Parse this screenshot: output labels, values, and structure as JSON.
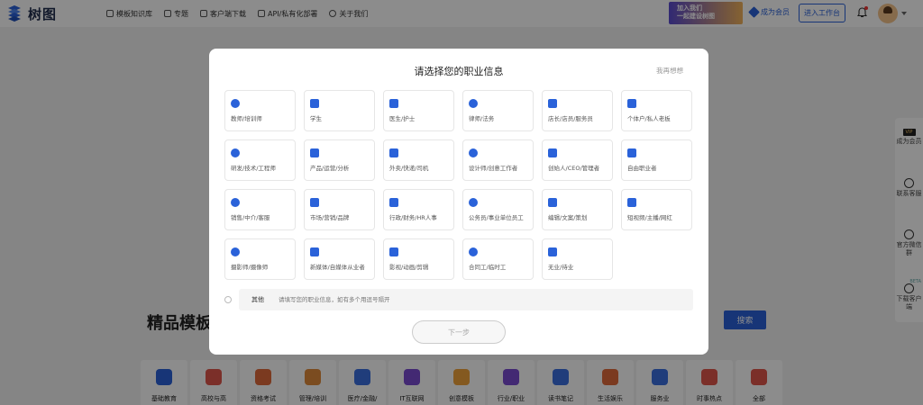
{
  "app": {
    "logo_text": "树图",
    "brand_color": "#2a62d9"
  },
  "nav": {
    "items": [
      {
        "label": "模板知识库",
        "icon": "grid-icon"
      },
      {
        "label": "专题",
        "icon": "bookmark-icon"
      },
      {
        "label": "客户端下载",
        "icon": "download-icon"
      },
      {
        "label": "API/私有化部署",
        "icon": "server-icon"
      },
      {
        "label": "关于我们",
        "icon": "gear-icon"
      }
    ],
    "promo_line1": "加入我们",
    "promo_line2": "一起建设树图",
    "vip_label": "成为会员",
    "workbench_label": "进入工作台"
  },
  "side_panel": {
    "vip_badge": "VIP",
    "items": [
      {
        "label": "成为会员"
      },
      {
        "label": "联系客服"
      },
      {
        "label": "官方微信群"
      },
      {
        "label": "下载客户端",
        "badge": "BETA"
      }
    ]
  },
  "page": {
    "section_title": "精品模板",
    "search_label": "搜索",
    "categories": [
      {
        "label": "基础教育",
        "color": "#2a62d9"
      },
      {
        "label": "高校与高",
        "color": "#e0564b"
      },
      {
        "label": "资格考试",
        "color": "#e06a3b"
      },
      {
        "label": "管理/培训",
        "color": "#e08a3b"
      },
      {
        "label": "医疗/金融/",
        "color": "#3b6fe0"
      },
      {
        "label": "IT互联网",
        "color": "#7a4bd1"
      },
      {
        "label": "创意模板",
        "color": "#f0a23b"
      },
      {
        "label": "行业/职业",
        "color": "#7a4bd1"
      },
      {
        "label": "读书笔记",
        "color": "#3b6fe0"
      },
      {
        "label": "生活娱乐",
        "color": "#e06a3b"
      },
      {
        "label": "服务业",
        "color": "#3b6fe0"
      },
      {
        "label": "时事热点",
        "color": "#e0564b"
      },
      {
        "label": "全部",
        "color": "#e0564b"
      }
    ]
  },
  "modal": {
    "title": "请选择您的职业信息",
    "skip_label": "我再想想",
    "options": [
      {
        "label": "教师/培训师",
        "icon": "graduation-cap-icon"
      },
      {
        "label": "学生",
        "icon": "student-cap-icon"
      },
      {
        "label": "医生/护士",
        "icon": "medical-kit-icon"
      },
      {
        "label": "律师/法务",
        "icon": "gavel-icon"
      },
      {
        "label": "店长/店员/服务员",
        "icon": "shop-icon"
      },
      {
        "label": "个体户/私人老板",
        "icon": "briefcase-icon"
      },
      {
        "label": "研发/技术/工程师",
        "icon": "code-icon"
      },
      {
        "label": "产品/运营/分析",
        "icon": "chart-icon"
      },
      {
        "label": "外卖/快递/司机",
        "icon": "delivery-icon"
      },
      {
        "label": "设计师/创意工作者",
        "icon": "palette-icon"
      },
      {
        "label": "创始人/CEO/管理者",
        "icon": "ceo-icon"
      },
      {
        "label": "自由职业者",
        "icon": "chat-icon"
      },
      {
        "label": "销售/中介/客服",
        "icon": "headset-icon"
      },
      {
        "label": "市场/营销/品牌",
        "icon": "tag-icon"
      },
      {
        "label": "行政/财务/HR人事",
        "icon": "folder-icon"
      },
      {
        "label": "公务员/事业单位员工",
        "icon": "building-icon"
      },
      {
        "label": "编辑/文案/策划",
        "icon": "edit-icon"
      },
      {
        "label": "短视频/主播/网红",
        "icon": "microphone-icon"
      },
      {
        "label": "摄影师/摄像师",
        "icon": "camera-icon"
      },
      {
        "label": "新媒体/自媒体从业者",
        "icon": "media-icon"
      },
      {
        "label": "影视/动画/剪辑",
        "icon": "film-reel-icon"
      },
      {
        "label": "合同工/临时工",
        "icon": "contract-icon"
      },
      {
        "label": "无业/待业",
        "icon": "person-icon"
      }
    ],
    "other_label": "其他",
    "other_placeholder": "请填写您的职业信息，如有多个用逗号隔开",
    "next_label": "下一步"
  }
}
